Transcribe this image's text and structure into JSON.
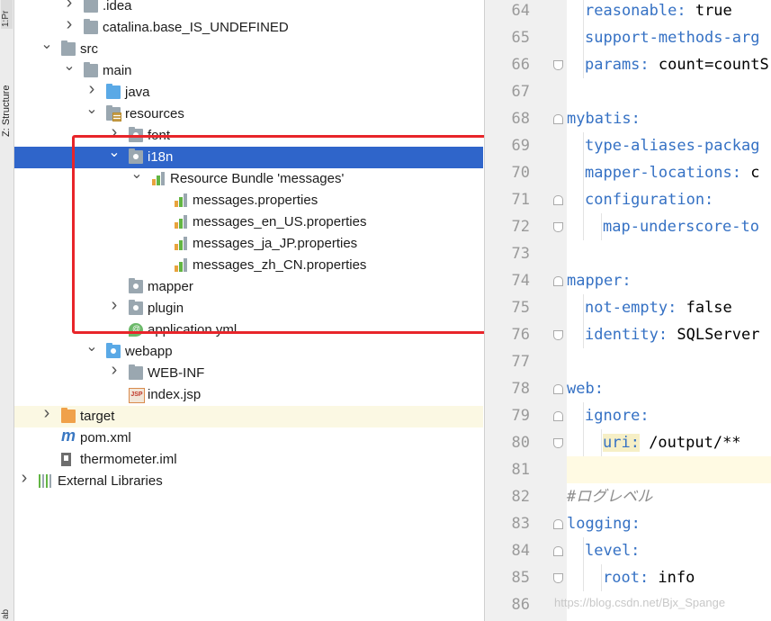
{
  "side_strip": {
    "top_label": "1:Pr",
    "structure_label": "Z: Structure",
    "bottom_label": "ab"
  },
  "tree": {
    "items": [
      {
        "label": ".idea",
        "arrow": "›",
        "icon": "folder-icon"
      },
      {
        "label": "catalina.base_IS_UNDEFINED",
        "arrow": "›",
        "icon": "folder-icon"
      },
      {
        "label": "src",
        "arrow": "⌄",
        "icon": "folder-icon"
      },
      {
        "label": "main",
        "arrow": "⌄",
        "icon": "folder-icon"
      },
      {
        "label": "java",
        "arrow": "›",
        "icon": "source-folder-icon"
      },
      {
        "label": "resources",
        "arrow": "⌄",
        "icon": "resources-folder-icon"
      },
      {
        "label": "font",
        "arrow": "›",
        "icon": "package-icon"
      },
      {
        "label": "i18n",
        "arrow": "⌄",
        "icon": "package-icon"
      },
      {
        "label": "Resource Bundle 'messages'",
        "arrow": "⌄",
        "icon": "resource-bundle-icon"
      },
      {
        "label": "messages.properties",
        "arrow": "",
        "icon": "properties-file-icon"
      },
      {
        "label": "messages_en_US.properties",
        "arrow": "",
        "icon": "properties-file-icon"
      },
      {
        "label": "messages_ja_JP.properties",
        "arrow": "",
        "icon": "properties-file-icon"
      },
      {
        "label": "messages_zh_CN.properties",
        "arrow": "",
        "icon": "properties-file-icon"
      },
      {
        "label": "mapper",
        "arrow": "",
        "icon": "package-icon"
      },
      {
        "label": "plugin",
        "arrow": "›",
        "icon": "package-icon"
      },
      {
        "label": "application.yml",
        "arrow": "",
        "icon": "yaml-file-icon"
      },
      {
        "label": "webapp",
        "arrow": "⌄",
        "icon": "web-folder-icon"
      },
      {
        "label": "WEB-INF",
        "arrow": "›",
        "icon": "folder-icon"
      },
      {
        "label": "index.jsp",
        "arrow": "",
        "icon": "jsp-file-icon"
      },
      {
        "label": "target",
        "arrow": "›",
        "icon": "excluded-folder-icon"
      },
      {
        "label": "pom.xml",
        "arrow": "",
        "icon": "maven-icon"
      },
      {
        "label": "thermometer.iml",
        "arrow": "",
        "icon": "iml-file-icon"
      },
      {
        "label": "External Libraries",
        "arrow": "›",
        "icon": "libraries-icon"
      }
    ],
    "jsp_badge": "JSP",
    "maven_glyph": "m"
  },
  "editor": {
    "line_numbers": [
      "64",
      "65",
      "66",
      "67",
      "68",
      "69",
      "70",
      "71",
      "72",
      "73",
      "74",
      "75",
      "76",
      "77",
      "78",
      "79",
      "80",
      "81",
      "82",
      "83",
      "84",
      "85",
      "86"
    ],
    "lines": [
      {
        "key": "reasonable:",
        "val": " true"
      },
      {
        "key": "support-methods-arg",
        "val": ""
      },
      {
        "key": "params:",
        "val": " count=countS"
      },
      {
        "key": "",
        "val": ""
      },
      {
        "key": "mybatis:",
        "val": ""
      },
      {
        "key": "type-aliases-packag",
        "val": ""
      },
      {
        "key": "mapper-locations:",
        "val": " c"
      },
      {
        "key": "configuration:",
        "val": ""
      },
      {
        "key": "map-underscore-to",
        "val": ""
      },
      {
        "key": "",
        "val": ""
      },
      {
        "key": "mapper:",
        "val": ""
      },
      {
        "key": "not-empty:",
        "val": " false"
      },
      {
        "key": "identity:",
        "val": " SQLServer"
      },
      {
        "key": "",
        "val": ""
      },
      {
        "key": "web:",
        "val": ""
      },
      {
        "key": "ignore:",
        "val": ""
      },
      {
        "key": "uri:",
        "val": " /output/**"
      },
      {
        "key": "",
        "val": ""
      },
      {
        "key": "",
        "val": "#ログレベル"
      },
      {
        "key": "logging:",
        "val": ""
      },
      {
        "key": "level:",
        "val": ""
      },
      {
        "key": "root:",
        "val": " info"
      },
      {
        "key": "",
        "val": ""
      }
    ]
  },
  "watermark": "https://blog.csdn.net/Bjx_Spange",
  "colors": {
    "selection": "#2f65ca",
    "highlight_box": "#e8252a",
    "yaml_key": "#3571c4"
  }
}
